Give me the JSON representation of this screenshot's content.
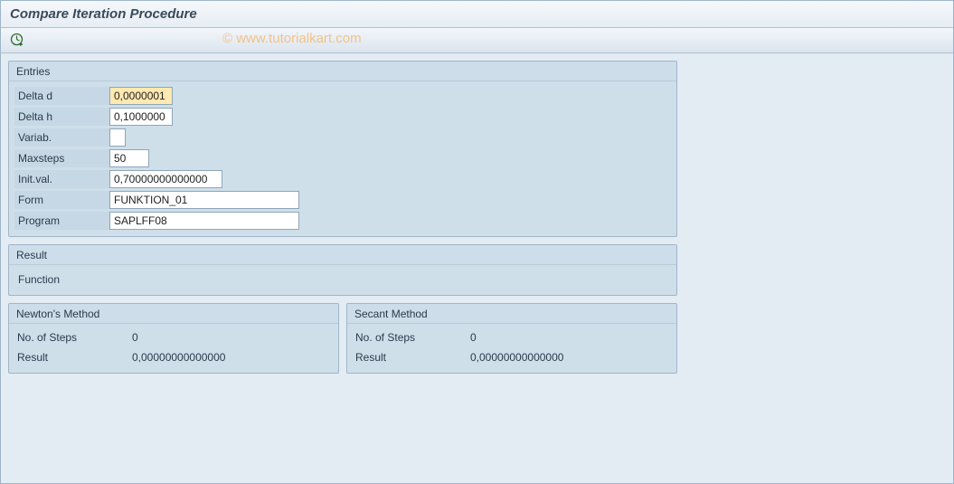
{
  "title": "Compare Iteration Procedure",
  "watermark": "© www.tutorialkart.com",
  "toolbar": {
    "execute_icon": "execute"
  },
  "entries": {
    "title": "Entries",
    "fields": {
      "delta_d": {
        "label": "Delta d",
        "value": "0,0000001"
      },
      "delta_h": {
        "label": "Delta h",
        "value": "0,1000000"
      },
      "variab": {
        "label": "Variab.",
        "value": ""
      },
      "maxsteps": {
        "label": "Maxsteps",
        "value": "50"
      },
      "initval": {
        "label": "Init.val.",
        "value": "0,70000000000000"
      },
      "form": {
        "label": "Form",
        "value": "FUNKTION_01"
      },
      "program": {
        "label": "Program",
        "value": "SAPLFF08"
      }
    }
  },
  "result": {
    "title": "Result",
    "function_label": "Function",
    "function_value": ""
  },
  "newton": {
    "title": "Newton's Method",
    "steps_label": "No. of Steps",
    "steps_value": "0",
    "result_label": "Result",
    "result_value": "0,00000000000000"
  },
  "secant": {
    "title": "Secant Method",
    "steps_label": "No. of Steps",
    "steps_value": "0",
    "result_label": "Result",
    "result_value": "0,00000000000000"
  }
}
